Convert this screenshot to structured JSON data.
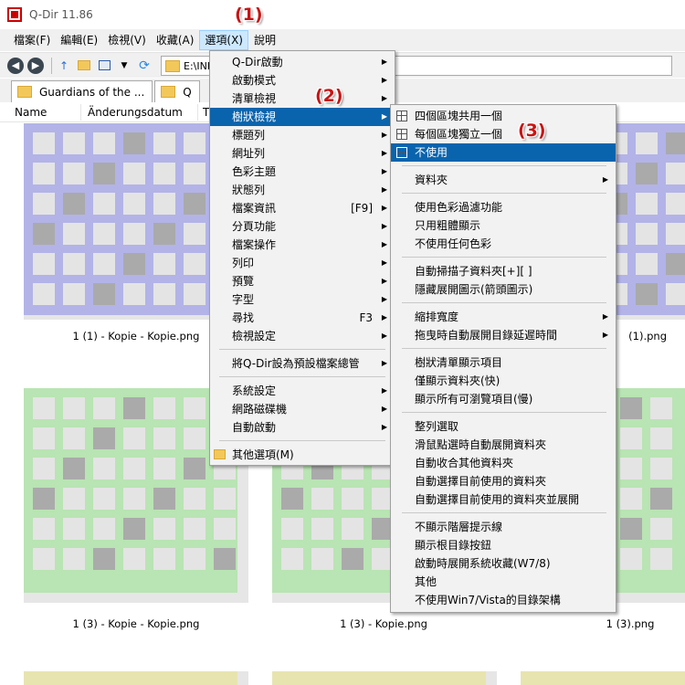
{
  "window": {
    "title": "Q-Dir 11.86"
  },
  "menubar": [
    {
      "label": "檔案(F)"
    },
    {
      "label": "編輯(E)"
    },
    {
      "label": "檢視(V)"
    },
    {
      "label": "收藏(A)"
    },
    {
      "label": "選項(X)"
    },
    {
      "label": "說明"
    }
  ],
  "address": {
    "value": "E:\\INI"
  },
  "tabs": [
    {
      "label": "Guardians of the ..."
    },
    {
      "label": "Q"
    }
  ],
  "columns": [
    "Name",
    "Änderungsdatum",
    "T"
  ],
  "files": [
    {
      "name": "1 (1) - Kopie - Kopie.png",
      "color": "#b3b3e8"
    },
    {
      "name": "(1).png",
      "color": "#b3b3e8"
    },
    {
      "name": "1 (3) - Kopie - Kopie.png",
      "color": "#b9e4b3"
    },
    {
      "name": "1 (3) - Kopie.png",
      "color": "#b9e4b3"
    },
    {
      "name": "1 (3).png",
      "color": "#b9e4b3"
    }
  ],
  "options_menu": [
    {
      "label": "Q-Dir啟動",
      "submenu": true
    },
    {
      "label": "啟動模式",
      "submenu": true
    },
    {
      "label": "清單檢視",
      "submenu": true
    },
    {
      "label": "樹狀檢視",
      "submenu": true,
      "highlighted": true
    },
    {
      "label": "標題列",
      "submenu": true
    },
    {
      "label": "網址列",
      "submenu": true
    },
    {
      "label": "色彩主題",
      "submenu": true
    },
    {
      "label": "狀態列",
      "submenu": true
    },
    {
      "label": "檔案資訊",
      "shortcut": "[F9]",
      "submenu": true
    },
    {
      "label": "分頁功能",
      "submenu": true
    },
    {
      "label": "檔案操作",
      "submenu": true
    },
    {
      "label": "列印",
      "submenu": true
    },
    {
      "label": "預覽",
      "submenu": true
    },
    {
      "label": "字型",
      "submenu": true
    },
    {
      "label": "尋找",
      "shortcut": "F3",
      "submenu": true
    },
    {
      "label": "檢視設定",
      "submenu": true
    },
    {
      "separator": true
    },
    {
      "label": "將Q-Dir設為預設檔案總管",
      "submenu": true
    },
    {
      "separator": true
    },
    {
      "label": "系統設定",
      "submenu": true
    },
    {
      "label": "網路磁碟機",
      "submenu": true
    },
    {
      "label": "自動啟動",
      "submenu": true
    },
    {
      "separator": true
    },
    {
      "label": "其他選項(M)",
      "icon": "folder-icon"
    }
  ],
  "tree_menu": [
    {
      "label": "四個區塊共用一個",
      "icon": "grid-icon"
    },
    {
      "label": "每個區塊獨立一個",
      "icon": "grid-icon"
    },
    {
      "label": "不使用",
      "icon": "grid-icon",
      "highlighted": true
    },
    {
      "separator": true
    },
    {
      "label": "資料夾",
      "submenu": true
    },
    {
      "separator": true
    },
    {
      "label": "使用色彩過濾功能"
    },
    {
      "label": "只用粗體顯示"
    },
    {
      "label": "不使用任何色彩"
    },
    {
      "separator": true
    },
    {
      "label": "自動掃描子資料夾[+][ ]"
    },
    {
      "label": "隱藏展開圖示(箭頭圖示)"
    },
    {
      "separator": true
    },
    {
      "label": "縮排寬度",
      "submenu": true
    },
    {
      "label": "拖曳時自動展開目錄延遲時間",
      "submenu": true
    },
    {
      "separator": true
    },
    {
      "label": "樹狀清單顯示項目"
    },
    {
      "label": "僅顯示資料夾(快)"
    },
    {
      "label": "顯示所有可瀏覽項目(慢)"
    },
    {
      "separator": true
    },
    {
      "label": "整列選取"
    },
    {
      "label": "滑鼠點選時自動展開資料夾"
    },
    {
      "label": "自動收合其他資料夾"
    },
    {
      "label": "自動選擇目前使用的資料夾"
    },
    {
      "label": "自動選擇目前使用的資料夾並展開"
    },
    {
      "separator": true
    },
    {
      "label": "不顯示階層提示線"
    },
    {
      "label": "顯示根目錄按鈕"
    },
    {
      "label": "啟動時展開系統收藏(W7/8)"
    },
    {
      "label": "其他"
    },
    {
      "label": "不使用Win7/Vista的目錄架構"
    }
  ],
  "steps": [
    "(1)",
    "(2)",
    "(3)"
  ]
}
